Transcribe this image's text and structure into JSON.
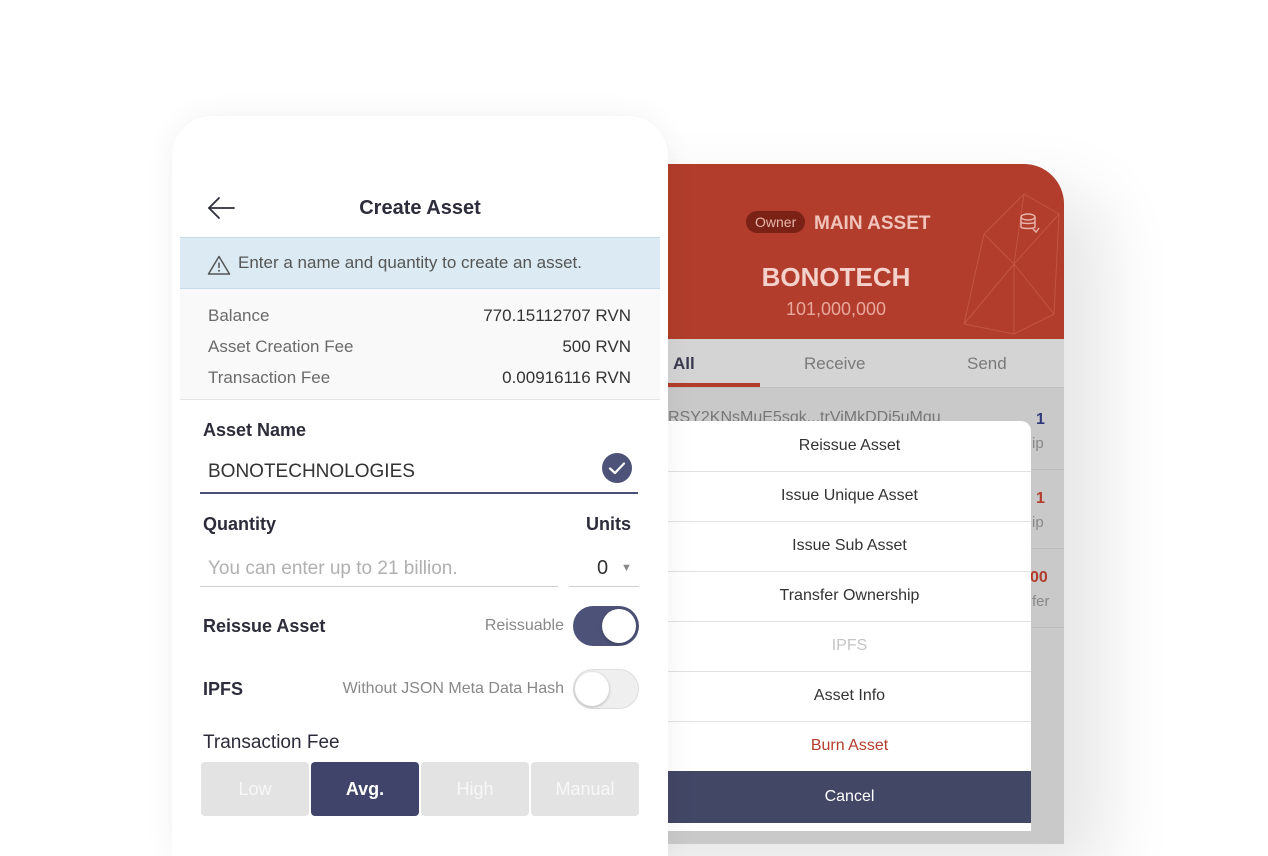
{
  "back_screen": {
    "owner_badge": "Owner",
    "header_label": "MAIN ASSET",
    "asset_name": "BONOTECH",
    "asset_amount": "101,000,000",
    "tabs": [
      "All",
      "Receive",
      "Send"
    ],
    "address": "RSY2KNsMuE5sqk...trViMkDDi5uMqu",
    "rows": [
      {
        "value": "1",
        "sub": "ip",
        "color": "#2f3a7a"
      },
      {
        "value": "1",
        "sub": "ip",
        "color": "#b23d2c"
      },
      {
        "value": "00",
        "sub": "fer",
        "color": "#b23d2c"
      }
    ],
    "action_sheet": {
      "items": [
        "Reissue Asset",
        "Issue Unique Asset",
        "Issue Sub Asset",
        "Transfer Ownership",
        "IPFS",
        "Asset Info",
        "Burn Asset"
      ],
      "cancel_label": "Cancel"
    }
  },
  "create_asset": {
    "title": "Create Asset",
    "info_message": "Enter a name and quantity to create an asset.",
    "fees": [
      {
        "label": "Balance",
        "value": "770.15112707 RVN"
      },
      {
        "label": "Asset Creation Fee",
        "value": "500 RVN"
      },
      {
        "label": "Transaction Fee",
        "value": "0.00916116 RVN"
      }
    ],
    "asset_name_label": "Asset Name",
    "asset_name_value": "BONOTECHNOLOGIES",
    "quantity_label": "Quantity",
    "quantity_placeholder": "You can enter up to 21 billion.",
    "units_label": "Units",
    "units_value": "0",
    "reissue_label": "Reissue Asset",
    "reissue_hint": "Reissuable",
    "reissue_on": true,
    "ipfs_label": "IPFS",
    "ipfs_hint": "Without JSON Meta Data Hash",
    "ipfs_on": false,
    "tx_fee_label": "Transaction Fee",
    "fee_options": [
      "Low",
      "Avg.",
      "High",
      "Manual"
    ],
    "fee_selected": "Avg."
  },
  "colors": {
    "brand_red": "#b23d2c",
    "navy": "#434766",
    "banner_bg": "#dcebf3"
  }
}
